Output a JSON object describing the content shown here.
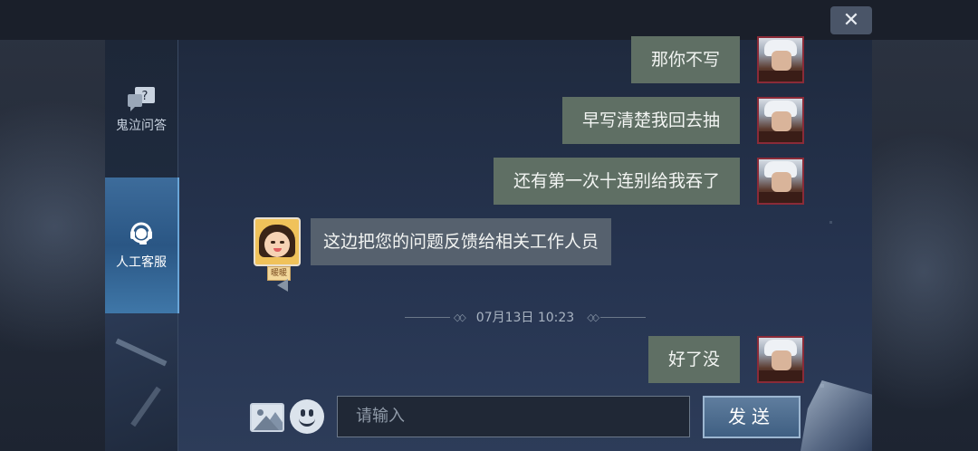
{
  "window": {
    "close_label": "✕"
  },
  "sidebar": {
    "items": [
      {
        "label": "鬼泣问答",
        "icon": "question-chat-icon"
      },
      {
        "label": "人工客服",
        "icon": "headset-icon"
      }
    ]
  },
  "messages": [
    {
      "side": "right",
      "text": "那你不写"
    },
    {
      "side": "right",
      "text": "早写清楚我回去抽"
    },
    {
      "side": "right",
      "text": "还有第一次十连别给我吞了"
    },
    {
      "side": "left",
      "text": "这边把您的问题反馈给相关工作人员",
      "agent_tag": "暖暖"
    },
    {
      "side": "right",
      "text": "好了没"
    }
  ],
  "timestamp": "07月13日 10:23",
  "composer": {
    "image_icon": "image-icon",
    "emoji_icon": "emoji-icon",
    "placeholder": "请输入",
    "send_label": "发送"
  }
}
